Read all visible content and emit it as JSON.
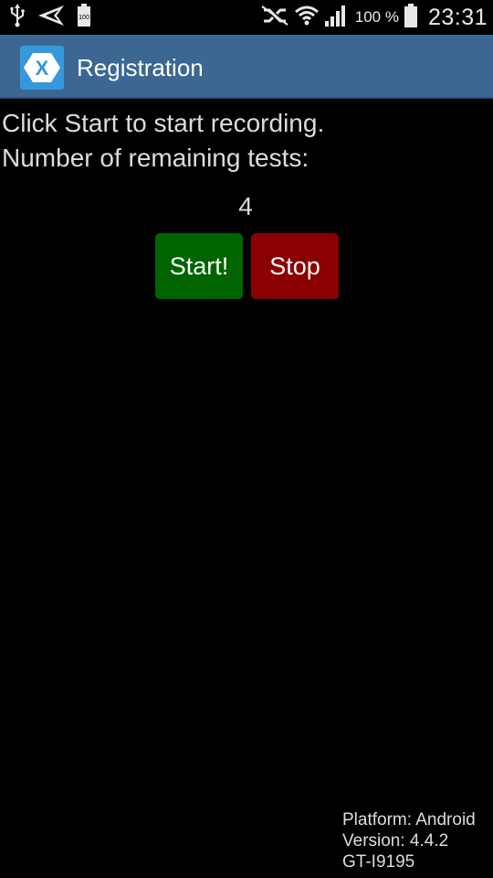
{
  "status_bar": {
    "icons_left": [
      "usb-icon",
      "send-icon",
      "battery-saver-icon"
    ],
    "icons_right": [
      "nfc-muted-icon",
      "wifi-icon",
      "signal-icon",
      "battery-icon"
    ],
    "battery_percent": "100 %",
    "time": "23:31",
    "battery_saver_text": "100"
  },
  "action_bar": {
    "title": "Registration",
    "accent_color": "#3c6792",
    "icon_color": "#3498db",
    "icon_letter": "X"
  },
  "main": {
    "instruction_line1": "Click Start to start recording.",
    "instruction_line2": "Number of remaining tests:",
    "remaining_count": "4",
    "start_button_label": "Start!",
    "stop_button_label": "Stop",
    "start_color": "#006400",
    "stop_color": "#8b0000"
  },
  "footer": {
    "platform": "Platform: Android",
    "version": "Version: 4.4.2",
    "device": "GT-I9195"
  }
}
